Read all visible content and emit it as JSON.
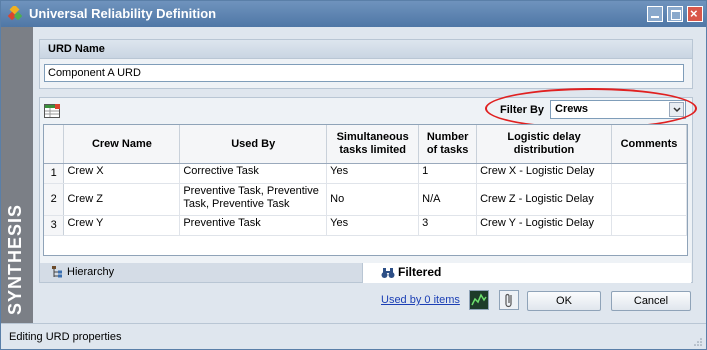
{
  "window": {
    "title": "Universal Reliability Definition",
    "brand": "SYNTHESIS"
  },
  "urd_name": {
    "label": "URD Name",
    "value": "Component A URD"
  },
  "filter": {
    "label": "Filter By",
    "selected": "Crews"
  },
  "table": {
    "columns": [
      "Crew Name",
      "Used By",
      "Simultaneous tasks limited",
      "Number of tasks",
      "Logistic delay distribution",
      "Comments"
    ],
    "rows": [
      {
        "num": "1",
        "crew_name": "Crew X",
        "used_by": "Corrective Task",
        "simultaneous": "Yes",
        "num_tasks": "1",
        "logistic": "Crew X - Logistic Delay",
        "comments": ""
      },
      {
        "num": "2",
        "crew_name": "Crew Z",
        "used_by": "Preventive Task, Preventive Task, Preventive Task",
        "simultaneous": "No",
        "num_tasks": "N/A",
        "logistic": "Crew Z - Logistic Delay",
        "comments": ""
      },
      {
        "num": "3",
        "crew_name": "Crew Y",
        "used_by": "Preventive Task",
        "simultaneous": "Yes",
        "num_tasks": "3",
        "logistic": "Crew Y - Logistic Delay",
        "comments": ""
      }
    ]
  },
  "tabs": {
    "hierarchy": "Hierarchy",
    "filtered": "Filtered"
  },
  "bottom": {
    "used_by": "Used by 0 items",
    "ok": "OK",
    "cancel": "Cancel"
  },
  "status": {
    "text": "Editing URD properties"
  },
  "colors": {
    "title_bar": "#4f77a6",
    "highlight": "#e02020",
    "link": "#1b3fb5"
  }
}
